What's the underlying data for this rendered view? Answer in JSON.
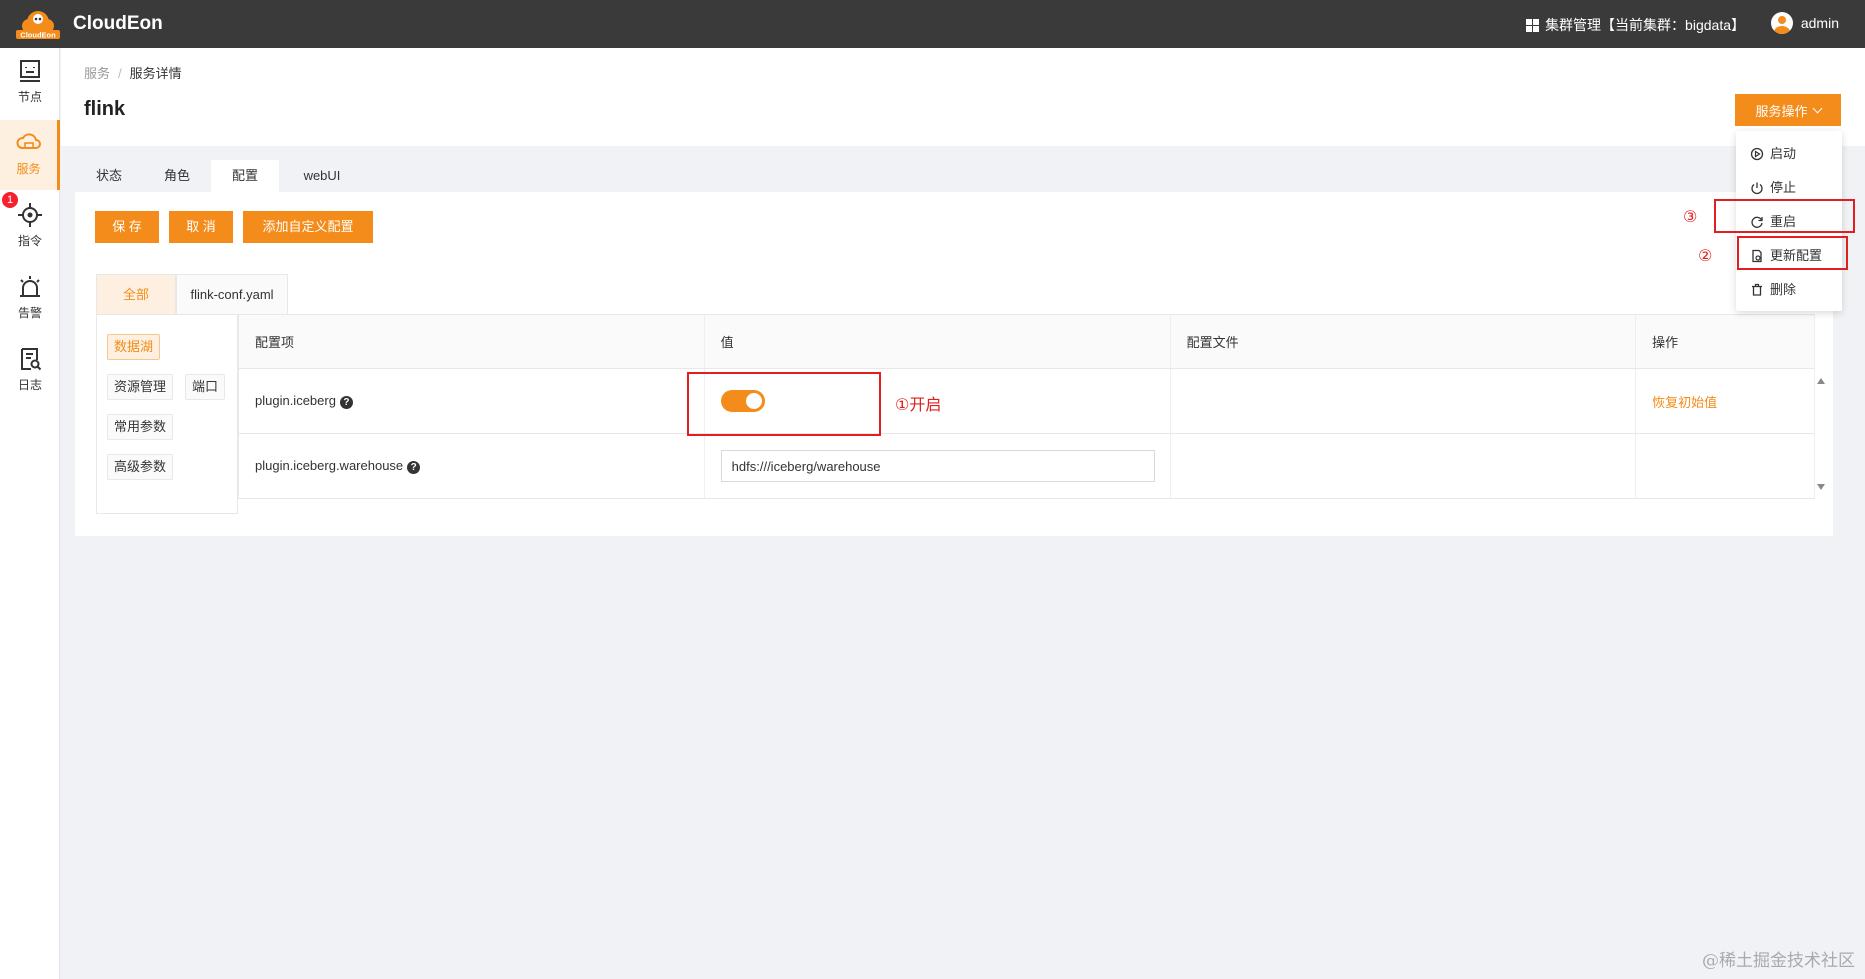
{
  "app": {
    "brand": "CloudEon",
    "logo_text": "CloudEon",
    "cluster_label": "集群管理【当前集群：bigdata】",
    "user": "admin"
  },
  "sidebar": {
    "items": [
      {
        "label": "节点",
        "icon": "node-icon"
      },
      {
        "label": "服务",
        "icon": "cloud-service-icon",
        "active": true
      },
      {
        "label": "指令",
        "icon": "command-icon",
        "badge": "1"
      },
      {
        "label": "告警",
        "icon": "alarm-icon"
      },
      {
        "label": "日志",
        "icon": "log-icon"
      }
    ]
  },
  "header": {
    "breadcrumb": [
      "服务",
      "服务详情"
    ],
    "separator": "/",
    "title": "flink",
    "service_ops_label": "服务操作"
  },
  "tabs": [
    "状态",
    "角色",
    "配置",
    "webUI"
  ],
  "active_tab": "配置",
  "toolbar": {
    "save_label": "保 存",
    "cancel_label": "取 消",
    "add_label": "添加自定义配置"
  },
  "file_tabs": [
    "全部",
    "flink-conf.yaml"
  ],
  "categories": [
    "数据湖",
    "资源管理",
    "端口",
    "常用参数",
    "高级参数"
  ],
  "table": {
    "headers": [
      "配置项",
      "值",
      "配置文件",
      "操作"
    ],
    "rows": [
      {
        "name": "plugin.iceberg",
        "help": "?",
        "value_type": "switch",
        "switch_on": true,
        "file": "",
        "action": "恢复初始值"
      },
      {
        "name": "plugin.iceberg.warehouse",
        "help": "?",
        "value": "hdfs:///iceberg/warehouse",
        "file": "",
        "action": ""
      }
    ]
  },
  "menu": {
    "items": [
      {
        "label": "启动",
        "icon": "play-circle-icon"
      },
      {
        "label": "停止",
        "icon": "power-icon"
      },
      {
        "label": "重启",
        "icon": "reload-icon"
      },
      {
        "label": "更新配置",
        "icon": "file-settings-icon"
      },
      {
        "label": "删除",
        "icon": "trash-icon"
      }
    ]
  },
  "annotations": {
    "a1": "①开启",
    "a2": "②",
    "a3": "③"
  },
  "colors": {
    "accent": "#f38c1a",
    "topbar": "#3a3a3a",
    "annotation": "#e02020"
  },
  "watermark": "@稀土掘金技术社区"
}
